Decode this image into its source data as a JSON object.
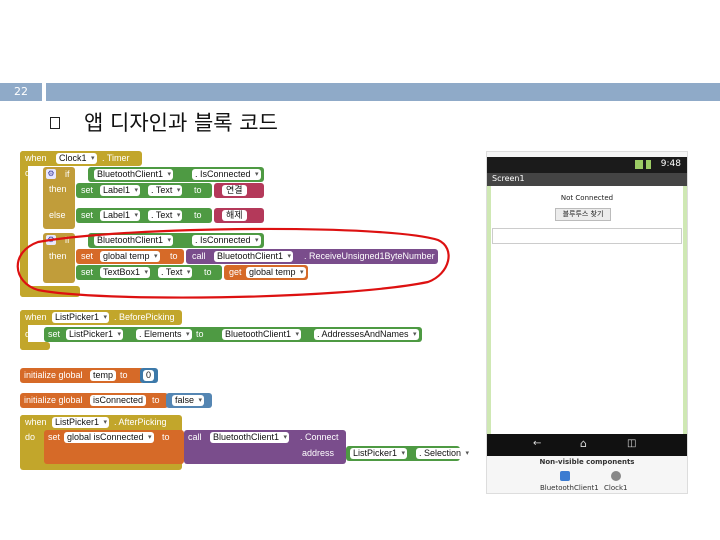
{
  "slide": {
    "number": "22",
    "title": "앱 디자인과 블록 코드"
  },
  "colors": {
    "header_bar": "#8faac8",
    "event_block": "#c2a62b",
    "component_block": "#4e9a43",
    "variable_block": "#d66a28",
    "procedure_block": "#7a4d8c",
    "annotation": "#dd1111"
  },
  "blocks": {
    "timer": {
      "when": "when",
      "do": "do",
      "component": "Clock1",
      "event": ". Timer",
      "if": "if",
      "then": "then",
      "else": "else",
      "cond_component": "BluetoothClient1",
      "cond_prop": ". IsConnected",
      "set": "set",
      "label_component": "Label1",
      "text_prop": ". Text",
      "to": "to",
      "connected_text": "연결",
      "disconnected_text": "해제",
      "if2": "if",
      "then2": "then",
      "cond2_component": "BluetoothClient1",
      "cond2_prop": ". IsConnected",
      "set_global": "set",
      "global_temp": "global temp",
      "to2": "to",
      "call": "call",
      "call_component": "BluetoothClient1",
      "call_method": ". ReceiveUnsigned1ByteNumber",
      "set2": "set",
      "textbox": "TextBox1",
      "text_prop2": ". Text",
      "to3": "to",
      "get": "get",
      "get_var": "global temp"
    },
    "before_picking": {
      "when": "when",
      "do": "do",
      "component": "ListPicker1",
      "event": ". BeforePicking",
      "set": "set",
      "target": "ListPicker1",
      "prop": ". Elements",
      "to": "to",
      "source": "BluetoothClient1",
      "source_prop": ". AddressesAndNames"
    },
    "init_temp": {
      "label": "initialize global",
      "name": "temp",
      "to": "to",
      "value": "0"
    },
    "init_connected": {
      "label": "initialize global",
      "name": "isConnected",
      "to": "to",
      "value": "false"
    },
    "after_picking": {
      "when": "when",
      "do": "do",
      "component": "ListPicker1",
      "event": ". AfterPicking",
      "set": "set",
      "var": "global isConnected",
      "to": "to",
      "call": "call",
      "call_component": "BluetoothClient1",
      "call_method": ". Connect",
      "address": "address",
      "arg_component": "ListPicker1",
      "arg_prop": ". Selection"
    }
  },
  "phone": {
    "time": "9:48",
    "screen_title": "Screen1",
    "status_label": "Not Connected",
    "button_label": "블루투스 찾기",
    "nonvisible_title": "Non-visible components",
    "nonvisible_items": [
      "BluetoothClient1",
      "Clock1"
    ]
  }
}
